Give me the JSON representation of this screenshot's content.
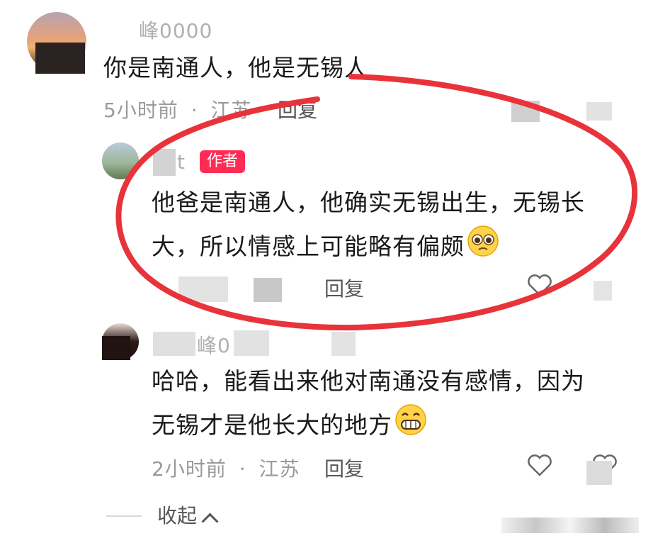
{
  "comments": [
    {
      "username": "峰0000",
      "text": "你是南通人，他是无锡人",
      "time": "5小时前",
      "location": "江苏",
      "reply_label": "回复"
    },
    {
      "username": "t",
      "author_badge": "作者",
      "text_line1": "他爸是南通人，他确实无锡出生，无锡长",
      "text_line2": "大，所以情感上可能略有偏颇",
      "reply_label": "回复",
      "emoji": "pleading-face-emoji"
    },
    {
      "username": "峰0",
      "text_line1": "哈哈，能看出来他对南通没有感情，因为",
      "text_line2": "无锡才是他长大的地方",
      "time": "2小时前",
      "location": "江苏",
      "reply_label": "回复",
      "emoji": "grinning-face-emoji"
    }
  ],
  "collapse_label": "收起",
  "separator": "·",
  "colors": {
    "badge": "#fe2c55",
    "annotation_circle": "#e8333a",
    "meta_text": "#9a9a9a"
  }
}
